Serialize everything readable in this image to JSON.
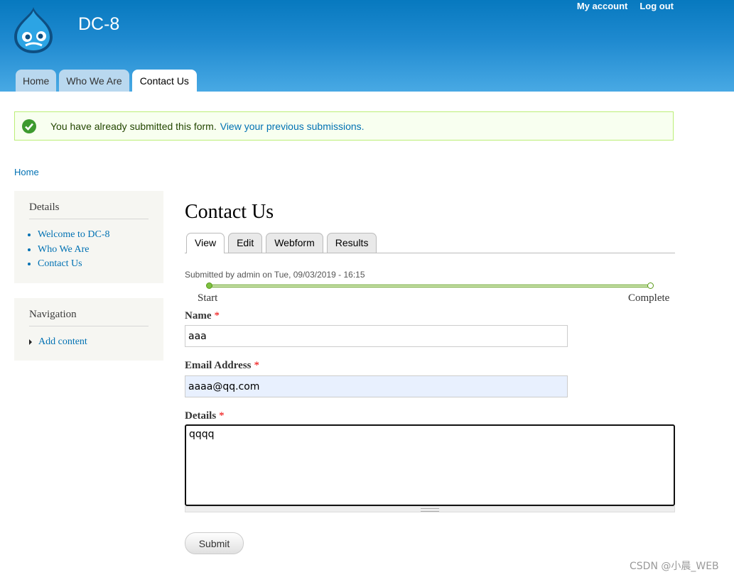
{
  "header": {
    "site_name": "DC-8",
    "secondary_menu": [
      "My account",
      "Log out"
    ],
    "main_menu": [
      {
        "label": "Home",
        "active": false
      },
      {
        "label": "Who We Are",
        "active": false
      },
      {
        "label": "Contact Us",
        "active": true
      }
    ]
  },
  "status": {
    "icon": "check-circle-icon",
    "text": "You have already submitted this form.",
    "link": "View your previous submissions."
  },
  "breadcrumb": "Home",
  "sidebar": {
    "details": {
      "title": "Details",
      "items": [
        "Welcome to DC-8",
        "Who We Are",
        "Contact Us"
      ]
    },
    "navigation": {
      "title": "Navigation",
      "items": [
        "Add content"
      ]
    }
  },
  "content": {
    "title": "Contact Us",
    "tabs": [
      {
        "label": "View",
        "active": true
      },
      {
        "label": "Edit",
        "active": false
      },
      {
        "label": "Webform",
        "active": false
      },
      {
        "label": "Results",
        "active": false
      }
    ],
    "submitted": "Submitted by admin on Tue, 09/03/2019 - 16:15",
    "progress": {
      "start": "Start",
      "end": "Complete"
    },
    "form": {
      "name_label": "Name",
      "name_value": "aaa",
      "email_label": "Email Address",
      "email_value": "aaaa@qq.com",
      "details_label": "Details",
      "details_value": "qqqq",
      "required_marker": "*",
      "submit_label": "Submit"
    }
  },
  "watermark": "CSDN @小晨_WEB",
  "colors": {
    "header_top": "#0779bf",
    "header_bottom": "#48a9e4",
    "link": "#0071b3",
    "status_bg": "#f8fff0",
    "status_check": "#3d9a2f"
  }
}
